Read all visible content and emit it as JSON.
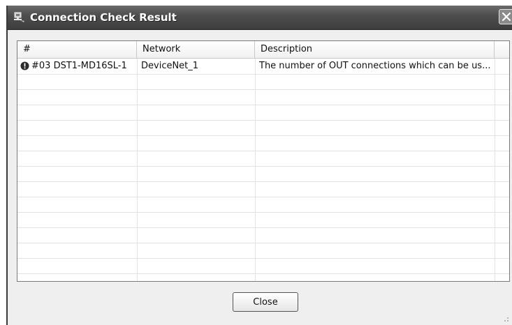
{
  "window": {
    "title": "Connection Check Result",
    "icon": "network-check-icon"
  },
  "table": {
    "columns": [
      "#",
      "Network",
      "Description"
    ],
    "rows": [
      {
        "icon": "warning-icon",
        "id": "#03 DST1-MD16SL-1",
        "network": "DeviceNet_1",
        "description": "The number of OUT connections which can be us..."
      }
    ],
    "empty_rows": 14
  },
  "buttons": {
    "close_label": "Close"
  },
  "colors": {
    "titlebar": "#4f4f4f",
    "window_bg": "#efefef",
    "warning_icon": "#2b2b2b"
  }
}
